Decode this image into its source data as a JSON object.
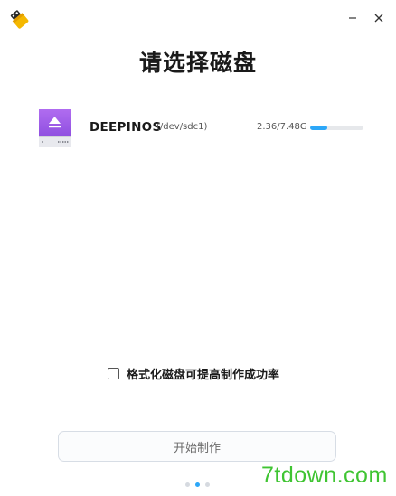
{
  "window": {
    "minimize_icon": "minimize-icon",
    "close_icon": "close-icon",
    "app_icon": "usb-drive-icon"
  },
  "page": {
    "title": "请选择磁盘"
  },
  "disks": [
    {
      "name": "DEEPINOS",
      "path": "(/dev/sdc1)",
      "size": "2.36/7.48G",
      "used_fraction": 0.315,
      "icon": "removable-drive-icon"
    }
  ],
  "options": {
    "format_label": "格式化磁盘可提高制作成功率",
    "format_checked": false
  },
  "actions": {
    "start_label": "开始制作"
  },
  "pagination": {
    "total": 3,
    "current": 2
  },
  "watermark": {
    "text": "7tdown.com"
  },
  "colors": {
    "accent": "#2ca7f8",
    "drive_icon_top": "#a25ee8",
    "watermark": "#3fc432"
  }
}
